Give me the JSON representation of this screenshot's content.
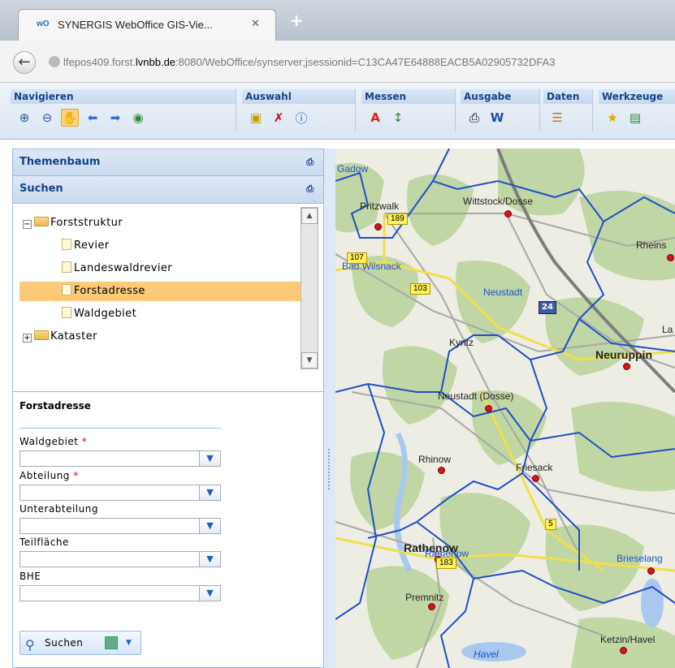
{
  "browser": {
    "tab_title": "SYNERGIS WebOffice GIS-Vie...",
    "tab_favicon": "wO",
    "tab_close": "✕",
    "new_tab": "+",
    "url_prefix": "lfepos409.forst.",
    "url_host_bold": "lvnbb.de",
    "url_rest": ":8080/WebOffice/synserver;jsessionid=C13CA47E64888EACB5A02905732DFA3"
  },
  "toolbar": {
    "groups": [
      {
        "title": "Navigieren",
        "icons": [
          "zoom-in-icon",
          "zoom-out-icon",
          "pan-hand-icon",
          "back-arrow-icon",
          "forward-arrow-icon",
          "globe-icon"
        ]
      },
      {
        "title": "Auswahl",
        "icons": [
          "select-icon",
          "deselect-icon",
          "info-icon"
        ]
      },
      {
        "title": "Messen",
        "icons": [
          "measure-area-icon",
          "measure-distance-icon"
        ]
      },
      {
        "title": "Ausgabe",
        "icons": [
          "print-icon",
          "word-export-icon"
        ]
      },
      {
        "title": "Daten",
        "icons": [
          "data-table-icon"
        ]
      },
      {
        "title": "Werkzeuge",
        "icons": [
          "tools-star-icon",
          "tools-map-icon"
        ]
      }
    ]
  },
  "panels": {
    "themenbaum": "Themenbaum",
    "suchen": "Suchen"
  },
  "tree": {
    "root": "Forststruktur",
    "children": [
      "Revier",
      "Landeswaldrevier",
      "Forstadresse",
      "Waldgebiet"
    ],
    "other": "Kataster",
    "selected": "Forstadresse"
  },
  "form": {
    "title": "Forstadresse",
    "fields": [
      {
        "label": "Waldgebiet",
        "required": "*"
      },
      {
        "label": "Abteilung",
        "required": "*"
      },
      {
        "label": "Unterabteilung",
        "required": ""
      },
      {
        "label": "Teilfläche",
        "required": ""
      },
      {
        "label": "BHE",
        "required": ""
      }
    ],
    "search_button": "Suchen"
  },
  "map": {
    "labels": {
      "gadow": "Gadow",
      "pritzwalk": "Pritzwalk",
      "wittstock": "Wittstock/Dosse",
      "rheinsberg": "Rheins",
      "bad_wilsnack": "Bad Wilsnack",
      "neustadt": "Neustadt",
      "kyritz": "Kyritz",
      "neuruppin": "Neuruppin",
      "neustadt_dosse": "Neustadt (Dosse)",
      "rhinow": "Rhinow",
      "friesack": "Friesack",
      "rathenow": "Rathenow",
      "rathenow_blue": "Rathenow",
      "premnitz": "Premnitz",
      "brieselang": "Brieselang",
      "ketzin": "Ketzin/Havel",
      "havel": "Havel",
      "la": "La"
    },
    "roads": {
      "r189": "189",
      "r107": "107",
      "r103": "103",
      "r5": "5",
      "r183": "183"
    },
    "highway": "24"
  }
}
